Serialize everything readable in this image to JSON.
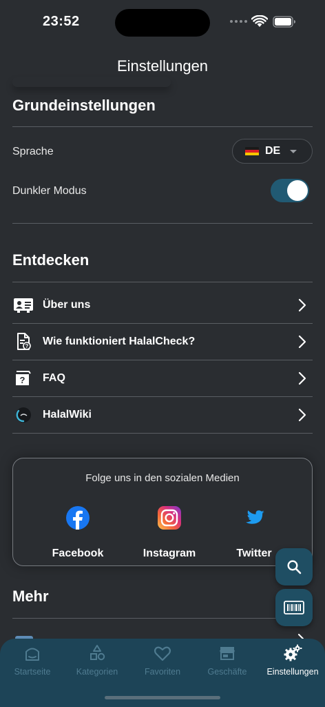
{
  "status_bar": {
    "time": "23:52"
  },
  "header": {
    "title": "Einstellungen"
  },
  "basic": {
    "title": "Grundeinstellungen",
    "language_label": "Sprache",
    "language_value": "DE",
    "dark_mode_label": "Dunkler Modus",
    "dark_mode_on": true
  },
  "discover": {
    "title": "Entdecken",
    "items": [
      {
        "label": "Über uns",
        "icon": "id-card-icon"
      },
      {
        "label": "Wie funktioniert HalalCheck?",
        "icon": "document-question-icon"
      },
      {
        "label": "FAQ",
        "icon": "faq-box-icon"
      },
      {
        "label": "HalalWiki",
        "icon": "halalwiki-logo-icon"
      }
    ]
  },
  "social": {
    "title": "Folge uns in den sozialen Medien",
    "items": [
      {
        "name": "Facebook",
        "icon": "facebook-icon"
      },
      {
        "name": "Instagram",
        "icon": "instagram-icon"
      },
      {
        "name": "Twitter",
        "icon": "twitter-icon"
      }
    ]
  },
  "more": {
    "title": "Mehr"
  },
  "fabs": [
    {
      "icon": "search-icon"
    },
    {
      "icon": "barcode-icon"
    }
  ],
  "tabbar": {
    "tabs": [
      {
        "label": "Startseite",
        "icon": "home-icon"
      },
      {
        "label": "Kategorien",
        "icon": "categories-icon"
      },
      {
        "label": "Favoriten",
        "icon": "heart-icon"
      },
      {
        "label": "Geschäfte",
        "icon": "store-icon"
      },
      {
        "label": "Einstellungen",
        "icon": "settings-icon",
        "active": true
      }
    ]
  },
  "colors": {
    "background": "#2a2d31",
    "accent": "#215a73",
    "tabbar": "#1d4457",
    "facebook": "#1877f2",
    "twitter": "#1d9bf0"
  }
}
